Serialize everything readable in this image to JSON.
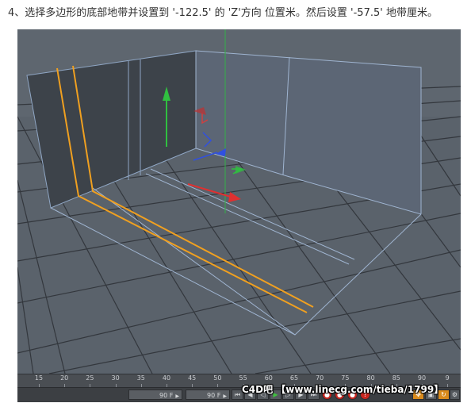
{
  "caption": "4、选择多边形的底部地带并设置到 '-122.5' 的 'Z'方向 位置米。然后设置 '-57.5' 地带厘米。",
  "timeline": {
    "ticks": [
      "15",
      "20",
      "25",
      "30",
      "35",
      "40",
      "45",
      "50",
      "55",
      "60",
      "65",
      "70",
      "75",
      "80",
      "85",
      "90",
      "9"
    ]
  },
  "controls": {
    "start_frame": "90 F",
    "end_frame": "90 F",
    "buttons": [
      "go-to-start",
      "prev-key",
      "prev-frame",
      "play",
      "next-frame",
      "next-key",
      "go-to-end",
      "record",
      "auto-key",
      "keyframe-selection",
      "help",
      "move-tool",
      "scale-tool",
      "rotate-tool",
      "record-active"
    ]
  },
  "watermark": "C4D吧 【www.linecg.com/tieba/1799】",
  "colors": {
    "viewport_bg": "#59606a",
    "grid": "#2e3238",
    "wall": "#3f454d",
    "wall_light": "#606a78",
    "edge": "#9fb4d0",
    "selected_edge": "#f0a020",
    "axis_x": "#e03030",
    "axis_y": "#30c040",
    "axis_z": "#3050e0"
  }
}
